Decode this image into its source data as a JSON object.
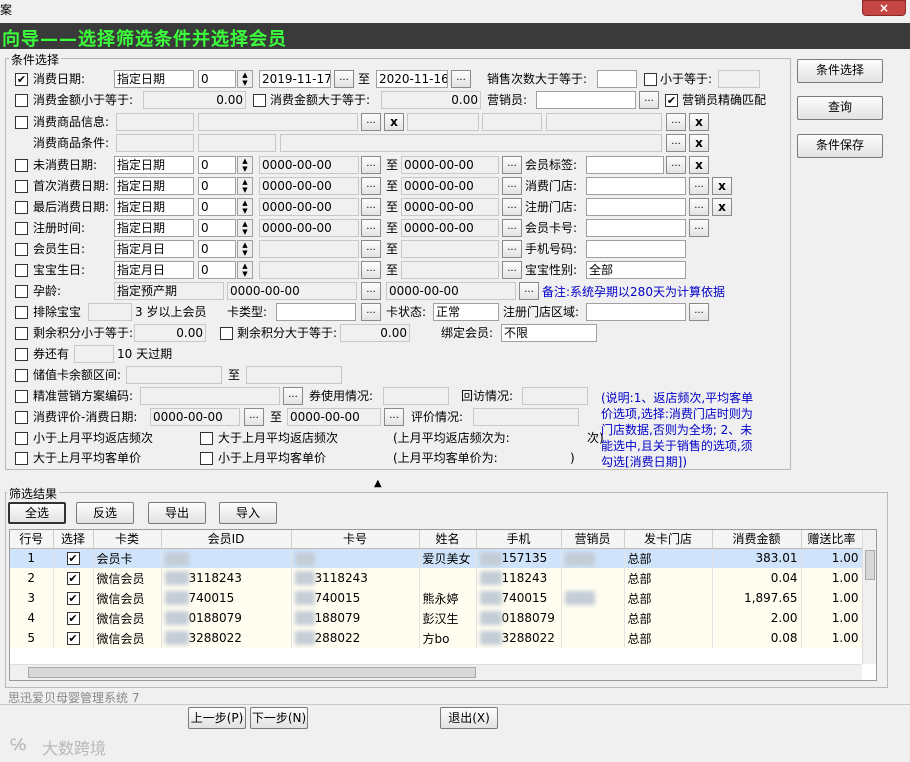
{
  "window": {
    "title": "案",
    "banner": "向导——选择筛选条件并选择会员",
    "close": "×"
  },
  "conditions": {
    "group_label": "条件选择",
    "row1": {
      "label": "消费日期:",
      "mode": "指定日期",
      "num": "0",
      "from": "2019-11-17",
      "to_label": "至",
      "to": "2020-11-16",
      "count_ge": "销售次数大于等于:",
      "count_le": "小于等于:"
    },
    "row2": {
      "amt_lt": "消费金额小于等于:",
      "amt_lt_val": "0.00",
      "amt_gt": "消费金额大于等于:",
      "amt_gt_val": "0.00",
      "seller": "营销员:",
      "exact": "营销员精确匹配"
    },
    "row3": {
      "label": "消费商品信息:"
    },
    "row4": {
      "label": "消费商品条件:"
    },
    "row5": {
      "label": "未消费日期:",
      "mode": "指定日期",
      "num": "0",
      "from": "0000-00-00",
      "to": "0000-00-00",
      "right": "会员标签:"
    },
    "row6": {
      "label": "首次消费日期:",
      "mode": "指定日期",
      "num": "0",
      "from": "0000-00-00",
      "to": "0000-00-00",
      "right": "消费门店:"
    },
    "row7": {
      "label": "最后消费日期:",
      "mode": "指定日期",
      "num": "0",
      "from": "0000-00-00",
      "to": "0000-00-00",
      "right": "注册门店:"
    },
    "row8": {
      "label": "注册时间:",
      "mode": "指定日期",
      "num": "0",
      "from": "0000-00-00",
      "to": "0000-00-00",
      "right": "会员卡号:"
    },
    "row9": {
      "label": "会员生日:",
      "mode": "指定月日",
      "num": "0",
      "right": "手机号码:"
    },
    "row10": {
      "label": "宝宝生日:",
      "mode": "指定月日",
      "num": "0",
      "right": "宝宝性别:",
      "right_val": "全部"
    },
    "row11": {
      "label": "孕龄:",
      "mode": "指定预产期",
      "from": "0000-00-00",
      "to": "0000-00-00",
      "note": "备注:系统孕期以280天为计算依据"
    },
    "row12": {
      "label": "排除宝宝",
      "age": "3 岁以上会员",
      "cardtype": "卡类型:",
      "cardstate": "卡状态:",
      "cardstate_val": "正常",
      "regarea": "注册门店区域:"
    },
    "row13": {
      "lt": "剩余积分小于等于:",
      "lt_val": "0.00",
      "gt": "剩余积分大于等于:",
      "gt_val": "0.00",
      "bind": "绑定会员:",
      "bind_val": "不限"
    },
    "row14": {
      "label": "券还有",
      "days": "10 天过期"
    },
    "row15": {
      "label": "储值卡余额区间:",
      "to_label": "至"
    },
    "row16": {
      "label": "精准营销方案编码:",
      "coupon": "券使用情况:",
      "visit": "回访情况:"
    },
    "row17": {
      "label": "消费评价-消费日期:",
      "from": "0000-00-00",
      "to_label": "至",
      "to": "0000-00-00",
      "eval": "评价情况:"
    },
    "row18": {
      "a": "小于上月平均返店频次",
      "b": "大于上月平均返店频次",
      "c": "(上月平均返店频次为:",
      "d": "次)"
    },
    "row19": {
      "a": "大于上月平均客单价",
      "b": "小于上月平均客单价",
      "c": "(上月平均客单价为:",
      "d": ")"
    },
    "help": "(说明:1、返店频次,平均客单价选项,选择:消费门店时则为门店数据,否则为全场; 2、未能选中,且关于销售的选项,须勾选[消费日期])",
    "ellipsis": "...",
    "x": "x"
  },
  "side_buttons": {
    "select": "条件选择",
    "query": "查询",
    "save": "条件保存"
  },
  "results": {
    "group_label": "筛选结果",
    "toolbar": {
      "all": "全选",
      "invert": "反选",
      "export": "导出",
      "import": "导入"
    },
    "columns": [
      "行号",
      "选择",
      "卡类",
      "会员ID",
      "卡号",
      "姓名",
      "手机",
      "营销员",
      "发卡门店",
      "消费金额",
      "赠送比率"
    ],
    "rows": [
      {
        "no": "1",
        "type": "会员卡",
        "id": "",
        "card": "",
        "name": "爱贝美女",
        "phone": "157135",
        "store": "总部",
        "amount": "383.01",
        "ratio": "1.00"
      },
      {
        "no": "2",
        "type": "微信会员",
        "id": "3118243",
        "card": "3118243",
        "name": "",
        "phone": "118243",
        "store": "总部",
        "amount": "0.04",
        "ratio": "1.00"
      },
      {
        "no": "3",
        "type": "微信会员",
        "id": "740015",
        "card": "740015",
        "name": "熊永婷",
        "phone": "740015",
        "store": "总部",
        "amount": "1,897.65",
        "ratio": "1.00"
      },
      {
        "no": "4",
        "type": "微信会员",
        "id": "0188079",
        "card": "188079",
        "name": "彭汉生",
        "phone": "0188079",
        "store": "总部",
        "amount": "2.00",
        "ratio": "1.00"
      },
      {
        "no": "5",
        "type": "微信会员",
        "id": "3288022",
        "card": "288022",
        "name": "方bo",
        "phone": "3288022",
        "store": "总部",
        "amount": "0.08",
        "ratio": "1.00"
      }
    ]
  },
  "footer": {
    "system": "思迅爱贝母婴管理系统 7",
    "prev": "上一步(P)",
    "next": "下一步(N)",
    "exit": "退出(X)",
    "watermark": "大数跨境"
  }
}
